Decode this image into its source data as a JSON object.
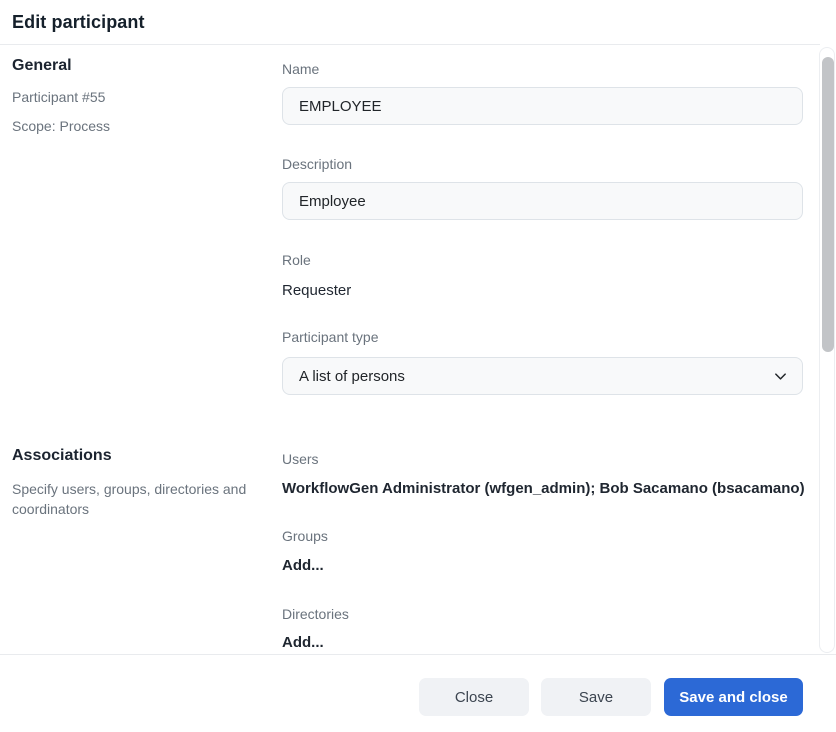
{
  "modal": {
    "title": "Edit participant"
  },
  "general": {
    "heading": "General",
    "participant_number": "Participant #55",
    "scope": "Scope: Process",
    "fields": {
      "name": {
        "label": "Name",
        "value": "EMPLOYEE"
      },
      "description": {
        "label": "Description",
        "value": "Employee"
      },
      "role": {
        "label": "Role",
        "value": "Requester"
      },
      "participant_type": {
        "label": "Participant type",
        "value": "A list of persons"
      }
    }
  },
  "associations": {
    "heading": "Associations",
    "description": "Specify users, groups, directories and coordinators",
    "users": {
      "label": "Users",
      "value": "WorkflowGen Administrator (wfgen_admin); Bob Sacamano (bsacamano)"
    },
    "groups": {
      "label": "Groups",
      "action": "Add..."
    },
    "directories": {
      "label": "Directories",
      "action": "Add..."
    }
  },
  "footer": {
    "close_label": "Close",
    "save_label": "Save",
    "save_and_close_label": "Save and close"
  },
  "colors": {
    "primary": "#2c69d6",
    "input_bg": "#f8f9fa",
    "input_border": "#dee3e8",
    "divider": "#e9ebee",
    "label_gray": "#6a737d"
  },
  "icons": {
    "participant_type_dropdown": "chevron-down"
  }
}
